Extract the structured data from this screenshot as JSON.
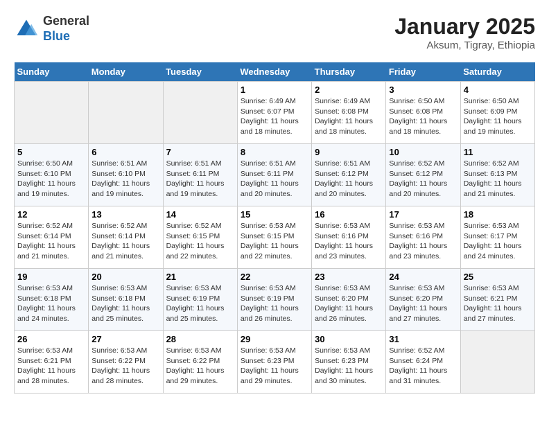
{
  "logo": {
    "general": "General",
    "blue": "Blue"
  },
  "title": "January 2025",
  "subtitle": "Aksum, Tigray, Ethiopia",
  "weekdays": [
    "Sunday",
    "Monday",
    "Tuesday",
    "Wednesday",
    "Thursday",
    "Friday",
    "Saturday"
  ],
  "weeks": [
    [
      {
        "day": "",
        "info": ""
      },
      {
        "day": "",
        "info": ""
      },
      {
        "day": "",
        "info": ""
      },
      {
        "day": "1",
        "info": "Sunrise: 6:49 AM\nSunset: 6:07 PM\nDaylight: 11 hours\nand 18 minutes."
      },
      {
        "day": "2",
        "info": "Sunrise: 6:49 AM\nSunset: 6:08 PM\nDaylight: 11 hours\nand 18 minutes."
      },
      {
        "day": "3",
        "info": "Sunrise: 6:50 AM\nSunset: 6:08 PM\nDaylight: 11 hours\nand 18 minutes."
      },
      {
        "day": "4",
        "info": "Sunrise: 6:50 AM\nSunset: 6:09 PM\nDaylight: 11 hours\nand 19 minutes."
      }
    ],
    [
      {
        "day": "5",
        "info": "Sunrise: 6:50 AM\nSunset: 6:10 PM\nDaylight: 11 hours\nand 19 minutes."
      },
      {
        "day": "6",
        "info": "Sunrise: 6:51 AM\nSunset: 6:10 PM\nDaylight: 11 hours\nand 19 minutes."
      },
      {
        "day": "7",
        "info": "Sunrise: 6:51 AM\nSunset: 6:11 PM\nDaylight: 11 hours\nand 19 minutes."
      },
      {
        "day": "8",
        "info": "Sunrise: 6:51 AM\nSunset: 6:11 PM\nDaylight: 11 hours\nand 20 minutes."
      },
      {
        "day": "9",
        "info": "Sunrise: 6:51 AM\nSunset: 6:12 PM\nDaylight: 11 hours\nand 20 minutes."
      },
      {
        "day": "10",
        "info": "Sunrise: 6:52 AM\nSunset: 6:12 PM\nDaylight: 11 hours\nand 20 minutes."
      },
      {
        "day": "11",
        "info": "Sunrise: 6:52 AM\nSunset: 6:13 PM\nDaylight: 11 hours\nand 21 minutes."
      }
    ],
    [
      {
        "day": "12",
        "info": "Sunrise: 6:52 AM\nSunset: 6:14 PM\nDaylight: 11 hours\nand 21 minutes."
      },
      {
        "day": "13",
        "info": "Sunrise: 6:52 AM\nSunset: 6:14 PM\nDaylight: 11 hours\nand 21 minutes."
      },
      {
        "day": "14",
        "info": "Sunrise: 6:52 AM\nSunset: 6:15 PM\nDaylight: 11 hours\nand 22 minutes."
      },
      {
        "day": "15",
        "info": "Sunrise: 6:53 AM\nSunset: 6:15 PM\nDaylight: 11 hours\nand 22 minutes."
      },
      {
        "day": "16",
        "info": "Sunrise: 6:53 AM\nSunset: 6:16 PM\nDaylight: 11 hours\nand 23 minutes."
      },
      {
        "day": "17",
        "info": "Sunrise: 6:53 AM\nSunset: 6:16 PM\nDaylight: 11 hours\nand 23 minutes."
      },
      {
        "day": "18",
        "info": "Sunrise: 6:53 AM\nSunset: 6:17 PM\nDaylight: 11 hours\nand 24 minutes."
      }
    ],
    [
      {
        "day": "19",
        "info": "Sunrise: 6:53 AM\nSunset: 6:18 PM\nDaylight: 11 hours\nand 24 minutes."
      },
      {
        "day": "20",
        "info": "Sunrise: 6:53 AM\nSunset: 6:18 PM\nDaylight: 11 hours\nand 25 minutes."
      },
      {
        "day": "21",
        "info": "Sunrise: 6:53 AM\nSunset: 6:19 PM\nDaylight: 11 hours\nand 25 minutes."
      },
      {
        "day": "22",
        "info": "Sunrise: 6:53 AM\nSunset: 6:19 PM\nDaylight: 11 hours\nand 26 minutes."
      },
      {
        "day": "23",
        "info": "Sunrise: 6:53 AM\nSunset: 6:20 PM\nDaylight: 11 hours\nand 26 minutes."
      },
      {
        "day": "24",
        "info": "Sunrise: 6:53 AM\nSunset: 6:20 PM\nDaylight: 11 hours\nand 27 minutes."
      },
      {
        "day": "25",
        "info": "Sunrise: 6:53 AM\nSunset: 6:21 PM\nDaylight: 11 hours\nand 27 minutes."
      }
    ],
    [
      {
        "day": "26",
        "info": "Sunrise: 6:53 AM\nSunset: 6:21 PM\nDaylight: 11 hours\nand 28 minutes."
      },
      {
        "day": "27",
        "info": "Sunrise: 6:53 AM\nSunset: 6:22 PM\nDaylight: 11 hours\nand 28 minutes."
      },
      {
        "day": "28",
        "info": "Sunrise: 6:53 AM\nSunset: 6:22 PM\nDaylight: 11 hours\nand 29 minutes."
      },
      {
        "day": "29",
        "info": "Sunrise: 6:53 AM\nSunset: 6:23 PM\nDaylight: 11 hours\nand 29 minutes."
      },
      {
        "day": "30",
        "info": "Sunrise: 6:53 AM\nSunset: 6:23 PM\nDaylight: 11 hours\nand 30 minutes."
      },
      {
        "day": "31",
        "info": "Sunrise: 6:52 AM\nSunset: 6:24 PM\nDaylight: 11 hours\nand 31 minutes."
      },
      {
        "day": "",
        "info": ""
      }
    ]
  ]
}
